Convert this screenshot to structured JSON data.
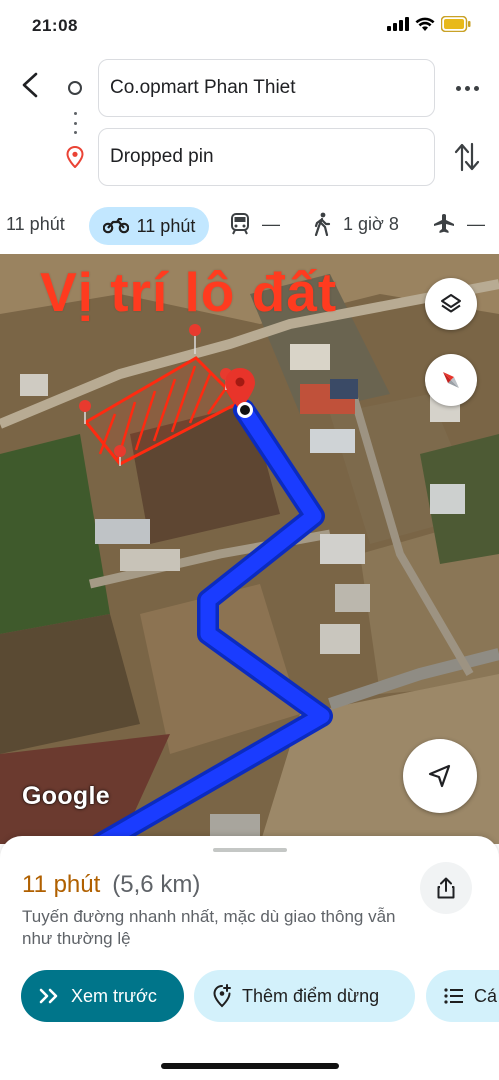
{
  "status_bar": {
    "time": "21:08"
  },
  "directions": {
    "origin": "Co.opmart Phan Thiet",
    "destination": "Dropped pin"
  },
  "modes": {
    "car": "11 phút",
    "motorbike": "11 phút",
    "transit": "—",
    "walk": "1 giờ 8",
    "flight": "—"
  },
  "map": {
    "overlay_title": "Vị trí lô đất",
    "attribution": "Google",
    "route_color": "#1a3cff",
    "parcel_color": "#ff2a10"
  },
  "sheet": {
    "eta": "11 phút",
    "distance": "(5,6 km)",
    "description": "Tuyến đường nhanh nhất, mặc dù giao thông vẫn như thường lệ",
    "actions": {
      "preview": "Xem trước",
      "add_stop": "Thêm điểm dừng",
      "steps": "Cá"
    }
  },
  "colors": {
    "accent": "#00758a",
    "chip_light": "#d3f1fb",
    "mode_selected_bg": "#c2e7ff",
    "eta": "#b06000"
  }
}
